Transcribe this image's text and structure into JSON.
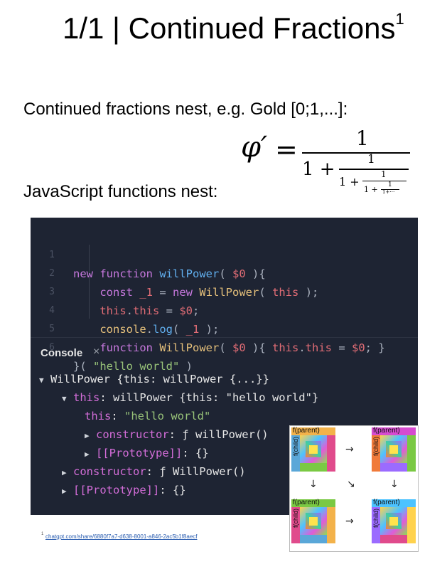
{
  "slide": {
    "title": "1/1 | Continued Fractions",
    "title_footnote_mark": "1",
    "intro_line": "Continued fractions nest, e.g. Gold [0;1,...]:",
    "js_line": "JavaScript functions nest:",
    "footnote_mark": "1",
    "footnote_link": "chatgpt.com/share/6880f7a7-d638-8001-a846-2ac5b1f8aecf"
  },
  "formula": {
    "lhs": "φ′",
    "eq": "=",
    "num1": "1",
    "one_plus_1": "1 +",
    "num2": "1",
    "one_plus_2": "1 +",
    "num3": "1",
    "one_plus_3": "1 +",
    "num4": "1",
    "tail": "1+⋯"
  },
  "editor": {
    "line_numbers": [
      "1",
      "2",
      "3",
      "4",
      "5",
      "6"
    ]
  },
  "console": {
    "tab_label": "Console",
    "close_glyph": "×"
  },
  "diagram": {
    "tile_top_label": "f(parent)",
    "tile_left_label": "f(child)",
    "arrows": [
      "→",
      "↓",
      "↘",
      "↓",
      "→"
    ]
  },
  "colors": {
    "panel_bg": "#1e2433",
    "keyword": "#c678dd",
    "function": "#61afef",
    "class": "#e5c07b",
    "string": "#98c379",
    "variable": "#e06c75",
    "link": "#2a5db0"
  }
}
